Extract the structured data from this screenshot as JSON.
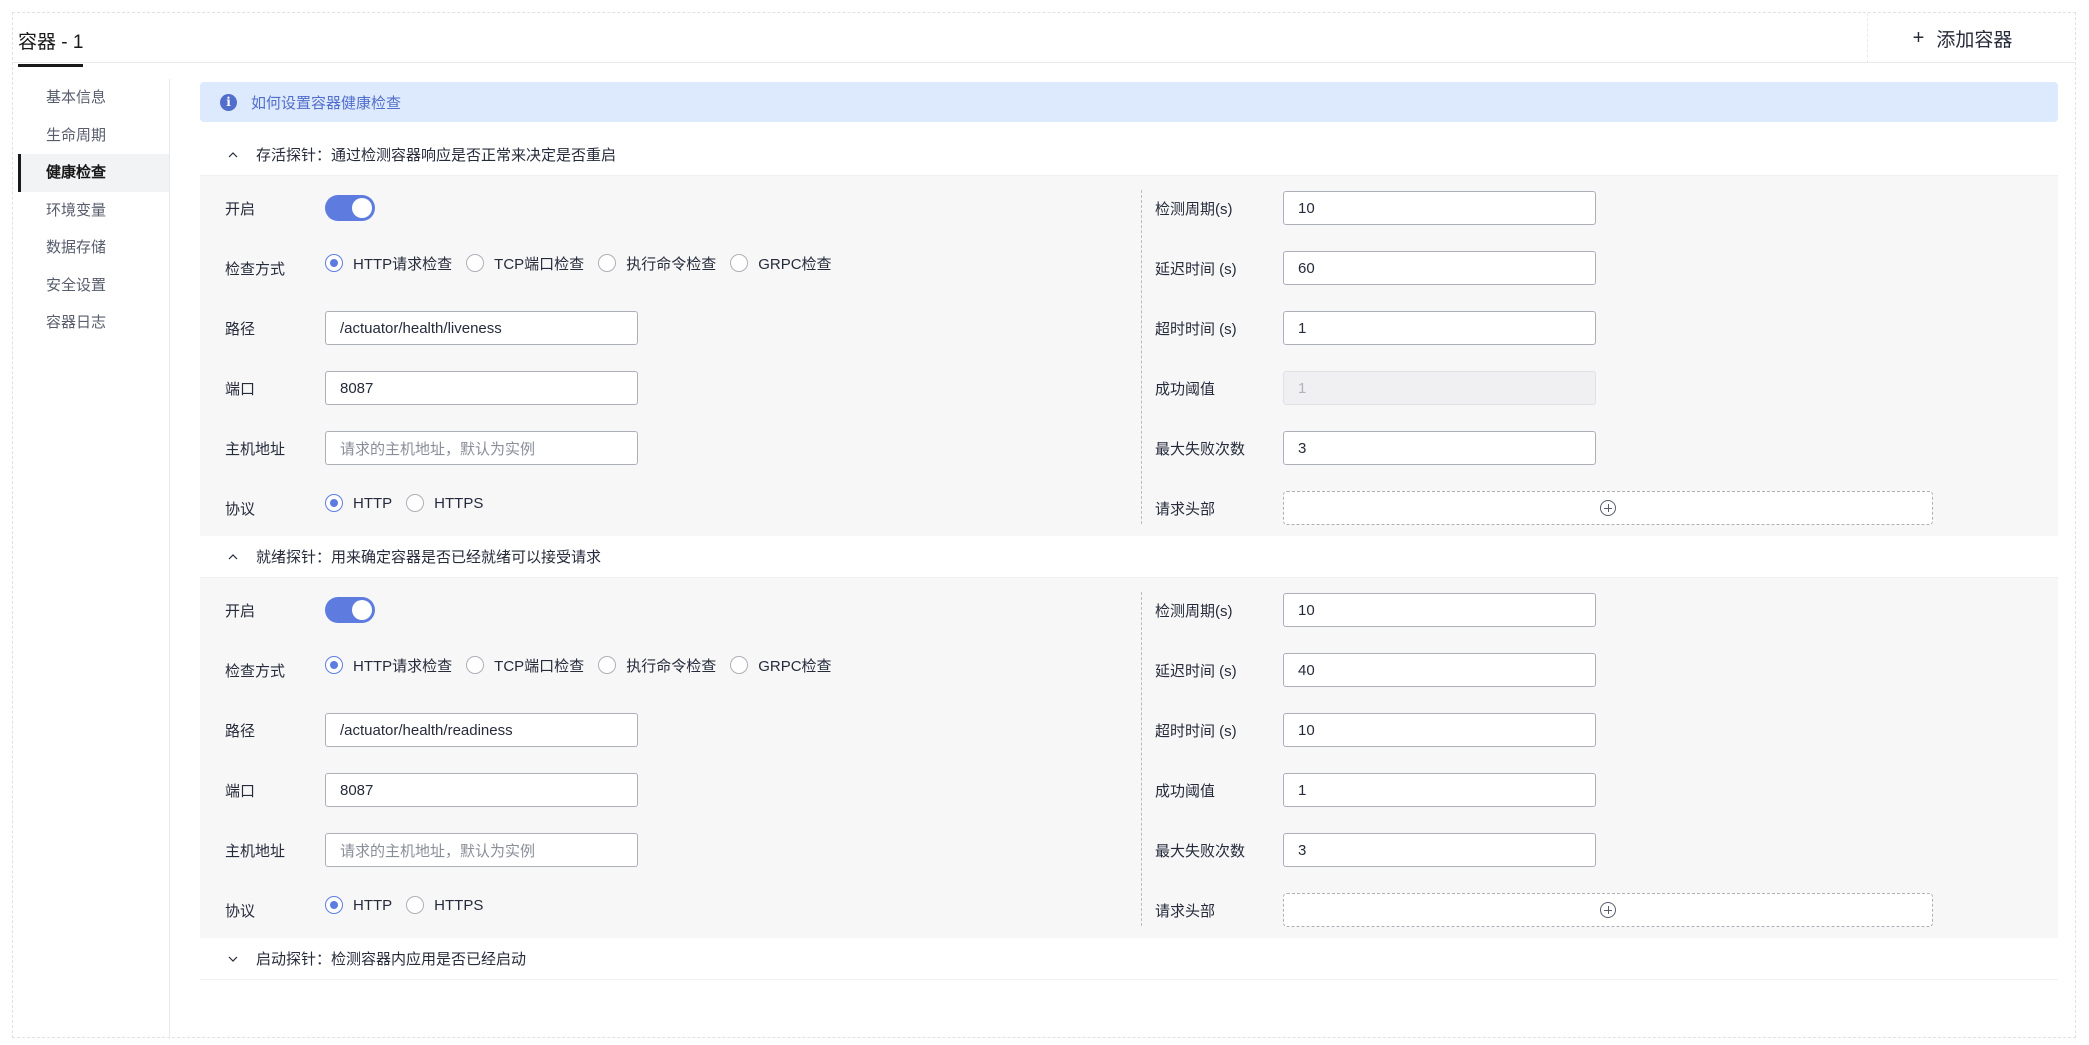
{
  "tabs": {
    "active": "容器 - 1",
    "add_label": "添加容器"
  },
  "sidebar": {
    "items": [
      {
        "label": "基本信息"
      },
      {
        "label": "生命周期"
      },
      {
        "label": "健康检查"
      },
      {
        "label": "环境变量"
      },
      {
        "label": "数据存储"
      },
      {
        "label": "安全设置"
      },
      {
        "label": "容器日志"
      }
    ],
    "active_index": 2
  },
  "info": {
    "text": "如何设置容器健康检查"
  },
  "labels": {
    "enable": "开启",
    "check_method": "检查方式",
    "path": "路径",
    "port": "端口",
    "host": "主机地址",
    "protocol": "协议",
    "period": "检测周期(s)",
    "delay": "延迟时间 (s)",
    "timeout": "超时时间 (s)",
    "success_threshold": "成功阈值",
    "max_failures": "最大失败次数",
    "request_headers": "请求头部"
  },
  "options": {
    "methods": [
      "HTTP请求检查",
      "TCP端口检查",
      "执行命令检查",
      "GRPC检查"
    ],
    "protocols": [
      "HTTP",
      "HTTPS"
    ]
  },
  "host_placeholder": "请求的主机地址，默认为实例",
  "liveness": {
    "title": "存活探针：通过检测容器响应是否正常来决定是否重启",
    "enabled": true,
    "method": "HTTP请求检查",
    "path": "/actuator/health/liveness",
    "port": "8087",
    "host": "",
    "protocol": "HTTP",
    "period": "10",
    "delay": "60",
    "timeout": "1",
    "success_threshold": "1",
    "max_failures": "3"
  },
  "readiness": {
    "title": "就绪探针：用来确定容器是否已经就绪可以接受请求",
    "enabled": true,
    "method": "HTTP请求检查",
    "path": "/actuator/health/readiness",
    "port": "8087",
    "host": "",
    "protocol": "HTTP",
    "period": "10",
    "delay": "40",
    "timeout": "10",
    "success_threshold": "1",
    "max_failures": "3"
  },
  "startup": {
    "title": "启动探针：检测容器内应用是否已经启动"
  }
}
